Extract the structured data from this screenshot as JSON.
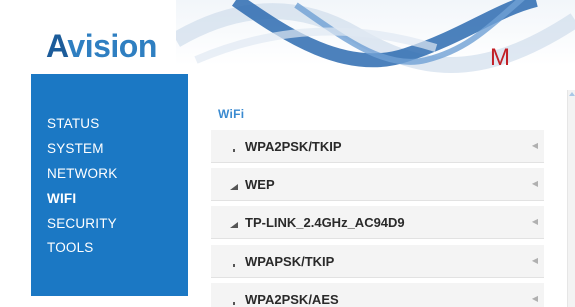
{
  "logo": {
    "first": "A",
    "rest": "vision"
  },
  "brand_mark": {
    "m1": "M",
    "m2": ""
  },
  "sidebar": {
    "items": [
      {
        "label": "STATUS",
        "active": false
      },
      {
        "label": "SYSTEM",
        "active": false
      },
      {
        "label": "NETWORK",
        "active": false
      },
      {
        "label": "WIFI",
        "active": true
      },
      {
        "label": "SECURITY",
        "active": false
      },
      {
        "label": "TOOLS",
        "active": false
      }
    ]
  },
  "wifi": {
    "title": "WiFi",
    "networks": [
      {
        "ssid": "WPA2PSK/TKIP",
        "signal_icon": "signal-low-icon"
      },
      {
        "ssid": "WEP",
        "signal_icon": "signal-medium-icon"
      },
      {
        "ssid": "TP-LINK_2.4GHz_AC94D9",
        "signal_icon": "signal-medium-icon"
      },
      {
        "ssid": "WPAPSK/TKIP",
        "signal_icon": "signal-low-icon"
      },
      {
        "ssid": "WPA2PSK/AES",
        "signal_icon": "signal-low-icon"
      }
    ],
    "row_icon": "chevron-left-icon"
  },
  "colors": {
    "sidebar_bg": "#1b78c4",
    "logo_blue": "#2f7fc1",
    "accent_title": "#3a8ad0",
    "brand_red": "#c21f26"
  }
}
